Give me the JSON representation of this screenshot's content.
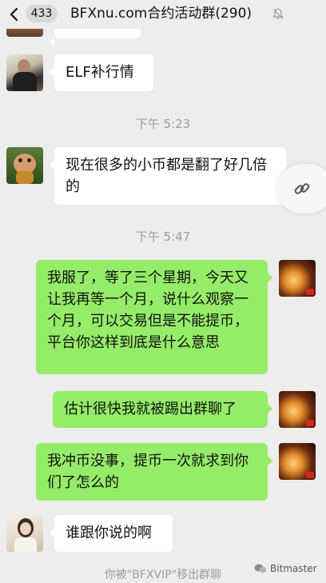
{
  "header": {
    "unread_count": "433",
    "title": "BFXnu.com合约活动群(290)"
  },
  "messages": [
    {
      "side": "left",
      "text": "ELF补行情"
    },
    {
      "side": "left",
      "text": "现在很多的小币都是翻了好几倍的"
    },
    {
      "side": "right",
      "text": "我服了，等了三个星期，今天又让我再等一个月，说什么观察一个月，可以交易但是不能提币，平台你这样到底是什么意思"
    },
    {
      "side": "right",
      "text": "估计很快我就被踢出群聊了"
    },
    {
      "side": "right",
      "text": "我冲币没事，提币一次就求到你们了怎么的"
    },
    {
      "side": "left",
      "text": "谁跟你说的啊"
    }
  ],
  "timestamps": [
    "下午 5:23",
    "下午 5:47"
  ],
  "system_message": "你被\"BFXVIP\"移出群聊",
  "watermark": "Bitmaster",
  "colors": {
    "background": "#ededed",
    "self_bubble": "#95ec69",
    "other_bubble": "#ffffff",
    "meta_text": "#9b9b9b"
  },
  "icons": [
    "back-chevron-icon",
    "mute-bell-icon",
    "link-icon",
    "wechat-icon",
    "flag-icon"
  ]
}
